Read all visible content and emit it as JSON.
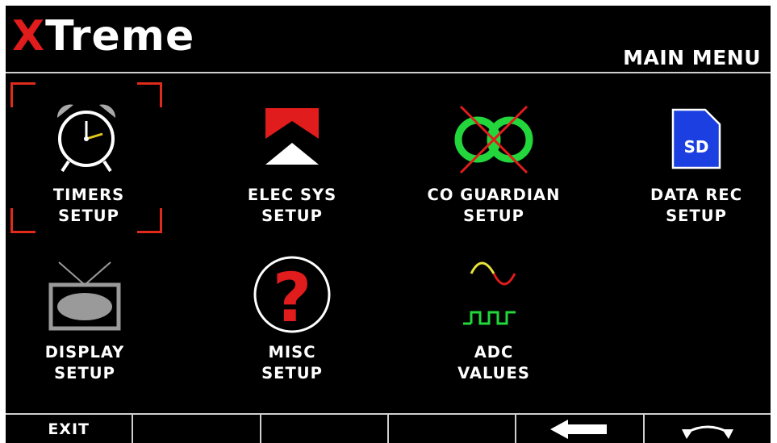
{
  "header": {
    "logo_x": "X",
    "logo_rest": "Treme",
    "screen_title": "MAIN MENU"
  },
  "colors": {
    "accent_red": "#e01c1c",
    "selection_bracket": "#e02a1c",
    "sd_blue": "#1b3fe0",
    "co_green": "#22d63c",
    "adc_yellow": "#e8e23a",
    "adc_green": "#22d63c"
  },
  "menu": {
    "selected_item": "timers-setup",
    "items": [
      {
        "icon": "alarm-clock-icon",
        "line1": "TIMERS",
        "line2": "SETUP"
      },
      {
        "icon": "elec-sys-arrows-icon",
        "line1": "ELEC SYS",
        "line2": "SETUP"
      },
      {
        "icon": "co-guardian-icon",
        "line1": "CO GUARDIAN",
        "line2": "SETUP"
      },
      {
        "icon": "sd-card-icon",
        "icon_text": "SD",
        "line1": "DATA REC",
        "line2": "SETUP"
      },
      {
        "icon": "tv-display-icon",
        "line1": "DISPLAY",
        "line2": "SETUP"
      },
      {
        "icon": "question-mark-icon",
        "line1": "MISC",
        "line2": "SETUP"
      },
      {
        "icon": "adc-waveform-icon",
        "line1": "ADC",
        "line2": "VALUES"
      }
    ]
  },
  "softkeys": [
    {
      "label": "EXIT",
      "icon": ""
    },
    {
      "label": "",
      "icon": ""
    },
    {
      "label": "",
      "icon": ""
    },
    {
      "label": "",
      "icon": ""
    },
    {
      "label": "",
      "icon": "left-arrow-icon"
    },
    {
      "label": "",
      "icon": "rotate-knob-icon"
    }
  ]
}
